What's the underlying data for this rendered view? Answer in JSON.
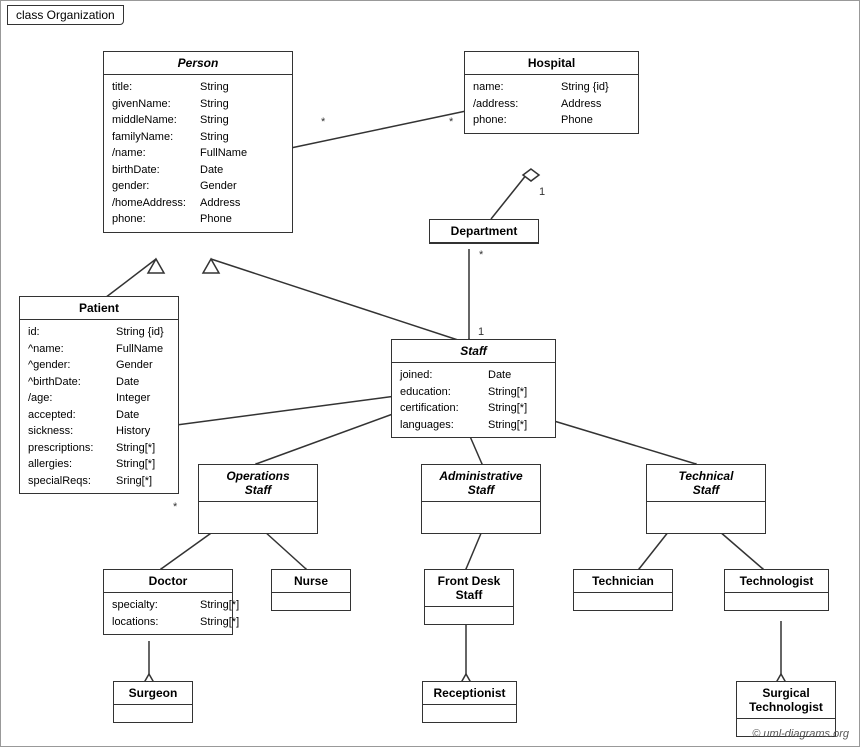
{
  "diagram": {
    "title": "class Organization",
    "copyright": "© uml-diagrams.org",
    "classes": {
      "person": {
        "name": "Person",
        "italic": true,
        "attrs": [
          {
            "name": "title:",
            "type": "String"
          },
          {
            "name": "givenName:",
            "type": "String"
          },
          {
            "name": "middleName:",
            "type": "String"
          },
          {
            "name": "familyName:",
            "type": "String"
          },
          {
            "name": "/name:",
            "type": "FullName"
          },
          {
            "name": "birthDate:",
            "type": "Date"
          },
          {
            "name": "gender:",
            "type": "Gender"
          },
          {
            "name": "/homeAddress:",
            "type": "Address"
          },
          {
            "name": "phone:",
            "type": "Phone"
          }
        ]
      },
      "hospital": {
        "name": "Hospital",
        "italic": false,
        "attrs": [
          {
            "name": "name:",
            "type": "String {id}"
          },
          {
            "name": "/address:",
            "type": "Address"
          },
          {
            "name": "phone:",
            "type": "Phone"
          }
        ]
      },
      "department": {
        "name": "Department",
        "italic": false,
        "attrs": []
      },
      "staff": {
        "name": "Staff",
        "italic": true,
        "attrs": [
          {
            "name": "joined:",
            "type": "Date"
          },
          {
            "name": "education:",
            "type": "String[*]"
          },
          {
            "name": "certification:",
            "type": "String[*]"
          },
          {
            "name": "languages:",
            "type": "String[*]"
          }
        ]
      },
      "patient": {
        "name": "Patient",
        "italic": false,
        "attrs": [
          {
            "name": "id:",
            "type": "String {id}"
          },
          {
            "name": "^name:",
            "type": "FullName"
          },
          {
            "name": "^gender:",
            "type": "Gender"
          },
          {
            "name": "^birthDate:",
            "type": "Date"
          },
          {
            "name": "/age:",
            "type": "Integer"
          },
          {
            "name": "accepted:",
            "type": "Date"
          },
          {
            "name": "sickness:",
            "type": "History"
          },
          {
            "name": "prescriptions:",
            "type": "String[*]"
          },
          {
            "name": "allergies:",
            "type": "String[*]"
          },
          {
            "name": "specialReqs:",
            "type": "Sring[*]"
          }
        ]
      },
      "operations_staff": {
        "name": "Operations\nStaff",
        "italic": true,
        "attrs": []
      },
      "administrative_staff": {
        "name": "Administrative\nStaff",
        "italic": true,
        "attrs": []
      },
      "technical_staff": {
        "name": "Technical\nStaff",
        "italic": true,
        "attrs": []
      },
      "doctor": {
        "name": "Doctor",
        "italic": false,
        "attrs": [
          {
            "name": "specialty:",
            "type": "String[*]"
          },
          {
            "name": "locations:",
            "type": "String[*]"
          }
        ]
      },
      "nurse": {
        "name": "Nurse",
        "italic": false,
        "attrs": []
      },
      "front_desk_staff": {
        "name": "Front Desk\nStaff",
        "italic": false,
        "attrs": []
      },
      "technician": {
        "name": "Technician",
        "italic": false,
        "attrs": []
      },
      "technologist": {
        "name": "Technologist",
        "italic": false,
        "attrs": []
      },
      "surgeon": {
        "name": "Surgeon",
        "italic": false,
        "attrs": []
      },
      "receptionist": {
        "name": "Receptionist",
        "italic": false,
        "attrs": []
      },
      "surgical_technologist": {
        "name": "Surgical\nTechnologist",
        "italic": false,
        "attrs": []
      }
    }
  }
}
